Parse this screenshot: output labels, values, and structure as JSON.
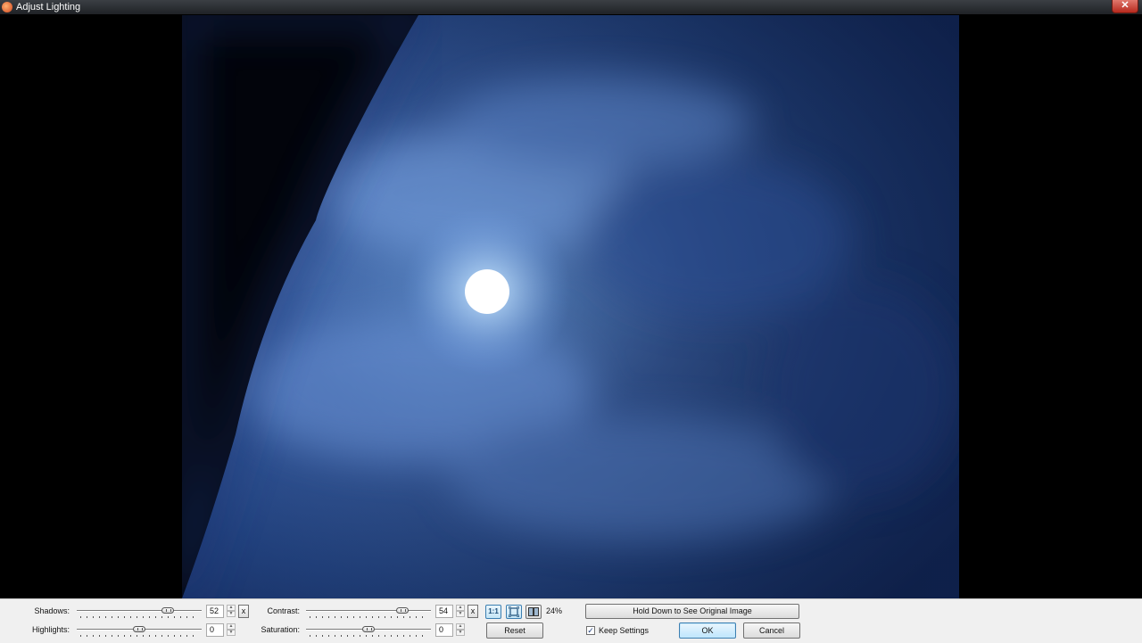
{
  "window": {
    "title": "Adjust Lighting",
    "close_glyph": "✕"
  },
  "controls": {
    "shadows": {
      "label": "Shadows:",
      "value": "52",
      "position": 0.73
    },
    "highlights": {
      "label": "Highlights:",
      "value": "0",
      "position": 0.5
    },
    "contrast": {
      "label": "Contrast:",
      "value": "54",
      "position": 0.77
    },
    "saturation": {
      "label": "Saturation:",
      "value": "0",
      "position": 0.5
    },
    "reset_x_label": "x",
    "spin_up": "▲",
    "spin_down": "▼"
  },
  "view": {
    "actual_size_label": "1:1",
    "fit_icon": "fit-to-window-icon",
    "compare_icon": "split-view-icon",
    "zoom_level": "24%"
  },
  "buttons": {
    "hold_original": "Hold Down to See Original Image",
    "reset": "Reset",
    "ok": "OK",
    "cancel": "Cancel"
  },
  "keep_settings": {
    "label": "Keep Settings",
    "checked": true,
    "check_glyph": "✓"
  },
  "colors": {
    "sky_dark": "#0b1a3d",
    "cloud": "#4f74b5",
    "moon": "#ffffff",
    "panel": "#f0f0f0"
  }
}
